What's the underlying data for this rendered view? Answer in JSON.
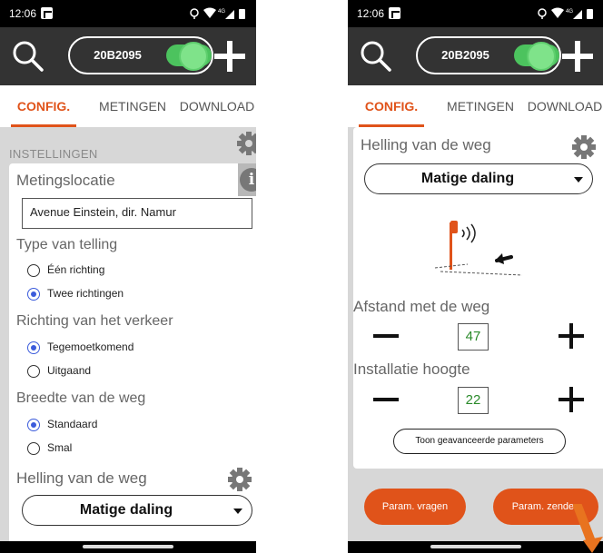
{
  "status_bar": {
    "time": "12:06"
  },
  "header": {
    "device_id": "20B2095"
  },
  "tabs": [
    {
      "label": "CONFIG.",
      "active": true
    },
    {
      "label": "METINGEN",
      "active": false
    },
    {
      "label": "DOWNLOAD",
      "active": false
    }
  ],
  "left_screen": {
    "settings_label": "INSTELLINGEN",
    "location_title": "Metingslocatie",
    "location_value": "Avenue Einstein, dir. Namur",
    "count_type": {
      "title": "Type van telling",
      "options": [
        {
          "label": "Één richting",
          "checked": false
        },
        {
          "label": "Twee richtingen",
          "checked": true
        }
      ]
    },
    "traffic_direction": {
      "title": "Richting van het verkeer",
      "options": [
        {
          "label": "Tegemoetkomend",
          "checked": true
        },
        {
          "label": "Uitgaand",
          "checked": false
        }
      ]
    },
    "road_width": {
      "title": "Breedte van de weg",
      "options": [
        {
          "label": "Standaard",
          "checked": true
        },
        {
          "label": "Smal",
          "checked": false
        }
      ]
    },
    "road_slope": {
      "title": "Helling van de weg",
      "selected": "Matige daling"
    }
  },
  "right_screen": {
    "road_slope": {
      "title": "Helling van de weg",
      "selected": "Matige daling"
    },
    "distance": {
      "title": "Afstand met de weg",
      "value": "47"
    },
    "height": {
      "title": "Installatie hoogte",
      "value": "22"
    },
    "advanced_button": "Toon geavanceerde parameters",
    "request_button": "Param. vragen",
    "send_button": "Param. zenden"
  },
  "colors": {
    "accent": "#e0531a",
    "toggle_on": "#4cc35e",
    "header_bg": "#333333",
    "radio_checked": "#3b5bdb",
    "value_green": "#2a8a2a"
  },
  "icons": [
    "search-icon",
    "plus-icon",
    "gear-icon",
    "info-icon",
    "chevron-down-icon",
    "radar-sensor-icon",
    "pointer-arrow-icon"
  ]
}
